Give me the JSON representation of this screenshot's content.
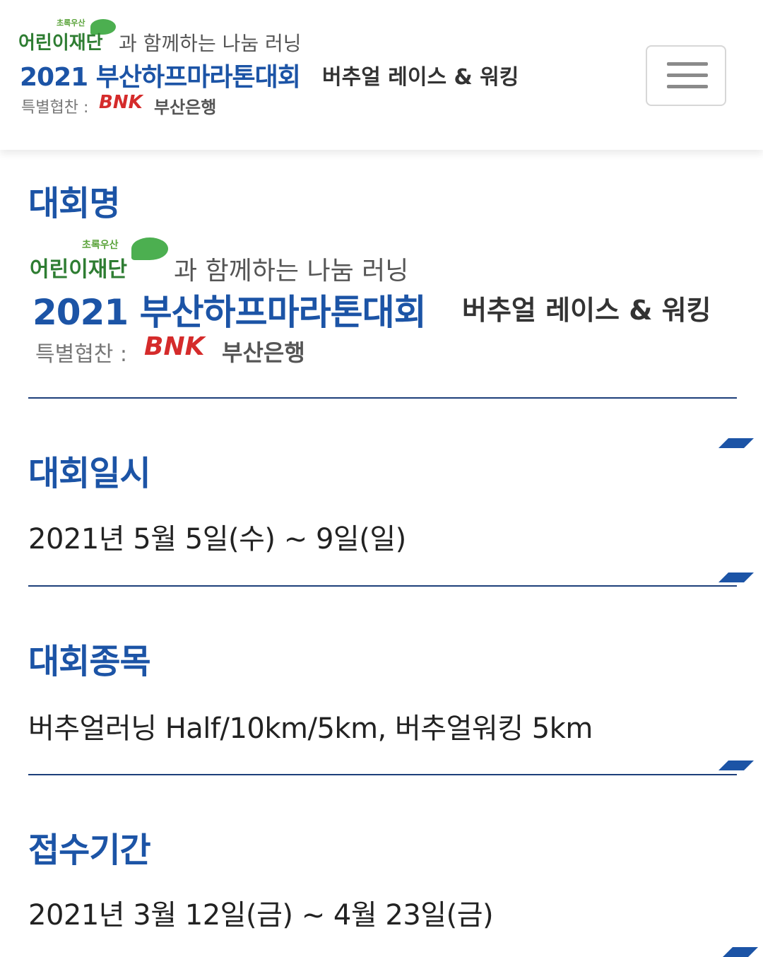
{
  "header": {
    "tagline_small": "초록우산",
    "org": "어린이재단",
    "with": "과 함께하는 나눔 러닝",
    "event": "2021 부산하프마라톤대회",
    "virtual": "버추얼 레이스 & 워킹",
    "sponsor_label": "특별협찬 :",
    "sponsor_bnk": "BNK",
    "sponsor_bank": "부산은행",
    "menu_icon": "hamburger-icon"
  },
  "sections": {
    "name": {
      "title": "대회명",
      "logo": {
        "tagline_small": "초록우산",
        "org": "어린이재단",
        "with": "과 함께하는 나눔 러닝",
        "event": "2021 부산하프마라톤대회",
        "virtual": "버추얼 레이스 & 워킹",
        "sponsor_label": "특별협찬 :",
        "sponsor_bnk": "BNK",
        "sponsor_bank": "부산은행"
      }
    },
    "date": {
      "title": "대회일시",
      "value": "2021년 5월 5일(수) ~ 9일(일)"
    },
    "events": {
      "title": "대회종목",
      "value": "버추얼러닝 Half/10km/5km, 버추얼워킹 5km"
    },
    "registration": {
      "title": "접수기간",
      "value": "2021년 3월 12일(금) ~ 4월 23일(금)"
    }
  },
  "colors": {
    "accent": "#1c54a6",
    "divider": "#1d3f7a",
    "green": "#2e7d32",
    "bnk_red": "#d52b2b"
  }
}
